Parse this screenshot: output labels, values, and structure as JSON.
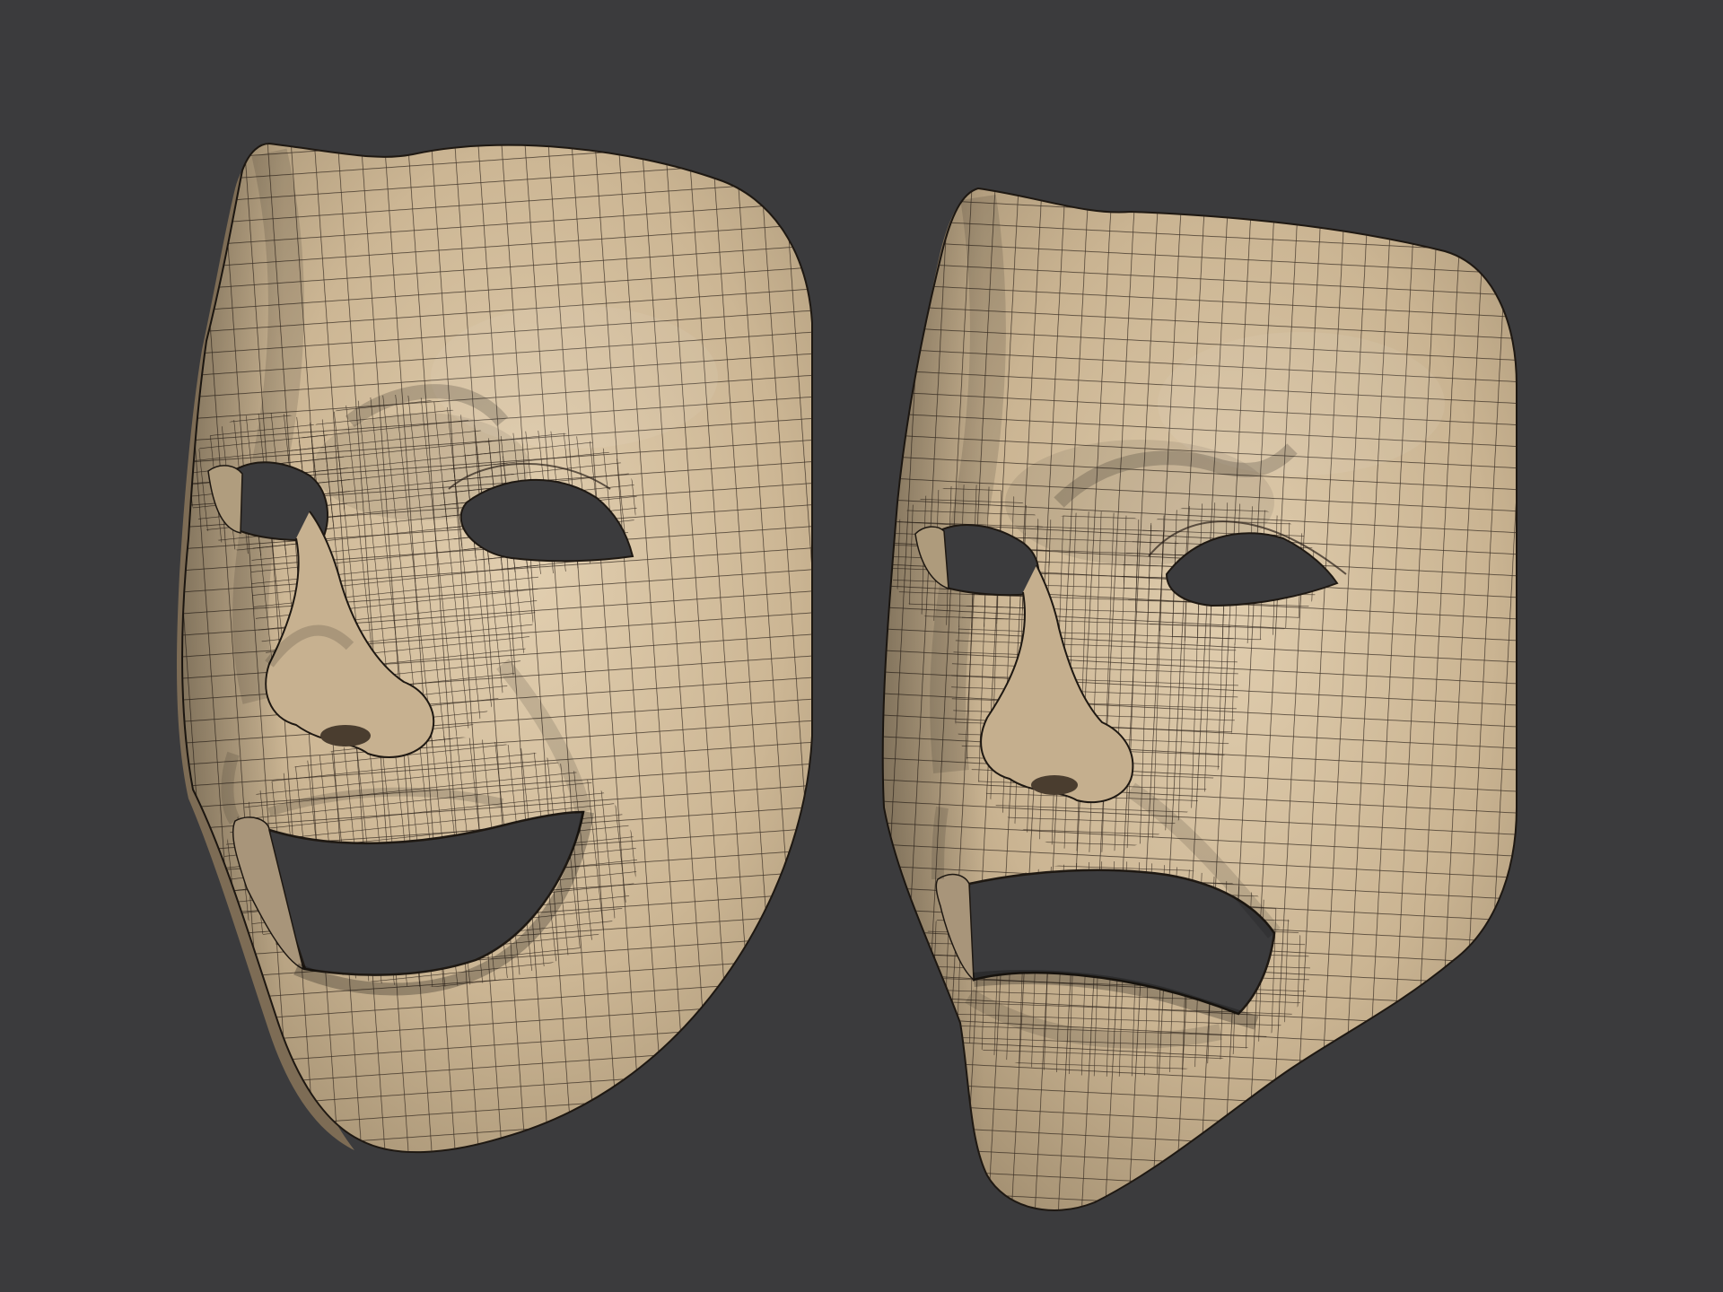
{
  "scene": {
    "background_color": "#3b3b3d",
    "surface_color": "#cdb898",
    "wire_color": "#2a2018",
    "objects": [
      {
        "name": "comedy-mask",
        "expression": "smiling"
      },
      {
        "name": "tragedy-mask",
        "expression": "frowning"
      }
    ]
  }
}
